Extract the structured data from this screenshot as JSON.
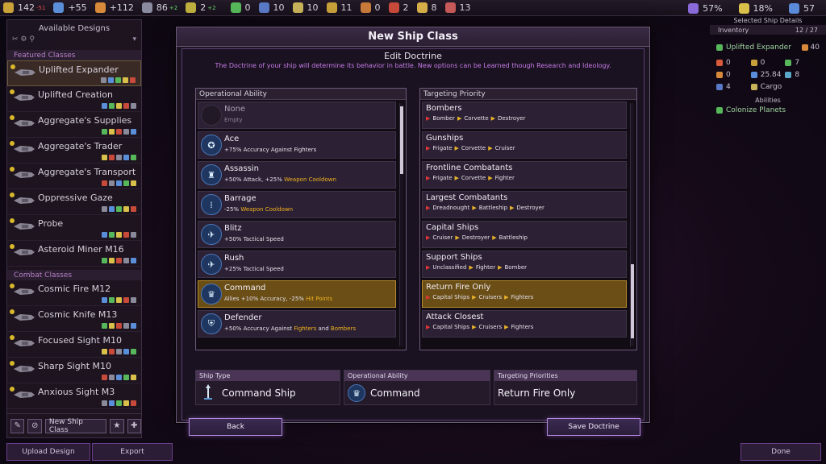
{
  "topbar": {
    "resources": [
      {
        "icon": "credits-icon",
        "value": "142",
        "delta": "-51",
        "delta_color": "red",
        "color": "#c9a23a"
      },
      {
        "icon": "science-icon",
        "value": "+55",
        "delta": "",
        "color": "#5a8ed8"
      },
      {
        "icon": "industry-icon",
        "value": "+112",
        "delta": "",
        "color": "#d88a3a"
      },
      {
        "icon": "manpower-icon",
        "value": "86",
        "delta": "+2",
        "delta_color": "green",
        "color": "#8a8aa0"
      },
      {
        "icon": "influence-icon",
        "value": "2",
        "delta": "+2",
        "delta_color": "green",
        "color": "#c0b040"
      }
    ],
    "strategic": [
      {
        "icon": "strategic-1-icon",
        "value": "0",
        "color": "#56b85a"
      },
      {
        "icon": "strategic-2-icon",
        "value": "10",
        "color": "#5a7ac8"
      },
      {
        "icon": "strategic-3-icon",
        "value": "10",
        "color": "#c8b25a"
      },
      {
        "icon": "strategic-4-icon",
        "value": "11",
        "color": "#c8a03a"
      },
      {
        "icon": "strategic-5-icon",
        "value": "0",
        "color": "#c87a3a"
      },
      {
        "icon": "strategic-6-icon",
        "value": "2",
        "color": "#c84a3a"
      },
      {
        "icon": "strategic-7-icon",
        "value": "8",
        "color": "#d8b04a"
      },
      {
        "icon": "strategic-8-icon",
        "value": "13",
        "color": "#c85a5a"
      }
    ],
    "right": [
      {
        "icon": "approval-icon",
        "value": "57%",
        "color": "#8a6ad8"
      },
      {
        "icon": "tax-icon",
        "value": "18%",
        "color": "#d8c04a"
      },
      {
        "icon": "population-icon",
        "value": "57",
        "color": "#5a8ad8"
      }
    ]
  },
  "left_panel": {
    "title": "Available Designs",
    "sections": [
      {
        "label": "Featured Classes",
        "items": [
          {
            "name": "Uplifted Expander",
            "selected": true
          },
          {
            "name": "Uplifted Creation",
            "selected": false
          },
          {
            "name": "Aggregate's Supplies",
            "selected": false
          },
          {
            "name": "Aggregate's Trader",
            "selected": false
          },
          {
            "name": "Aggregate's Transport",
            "selected": false
          },
          {
            "name": "Oppressive Gaze",
            "selected": false
          },
          {
            "name": "Probe",
            "selected": false
          },
          {
            "name": "Asteroid Miner M16",
            "selected": false
          }
        ]
      },
      {
        "label": "Combat Classes",
        "items": [
          {
            "name": "Cosmic Fire M12",
            "selected": false
          },
          {
            "name": "Cosmic Knife M13",
            "selected": false
          },
          {
            "name": "Focused Sight M10",
            "selected": false
          },
          {
            "name": "Sharp Sight M10",
            "selected": false
          },
          {
            "name": "Anxious Sight M3",
            "selected": false
          }
        ]
      }
    ],
    "new_ship_class_label": "New Ship Class",
    "upload_label": "Upload Design",
    "export_label": "Export"
  },
  "right_panel": {
    "header": "Selected Ship Details",
    "inventory_label": "Inventory",
    "inventory_value": "12 / 27",
    "ship_name": "Uplifted Expander",
    "ship_value": "40",
    "stats": [
      [
        "0",
        "0",
        "7"
      ],
      [
        "0",
        "25.84",
        "8"
      ],
      [
        "4",
        "Cargo",
        ""
      ]
    ],
    "abilities_label": "Abilities",
    "abilities": [
      "Colonize Planets"
    ],
    "done_label": "Done"
  },
  "modal": {
    "title": "New Ship Class",
    "subtitle": "Edit Doctrine",
    "description": "The Doctrine of your ship will determine its behavior in battle. New options can be Learned though Research and Ideology.",
    "operational_header": "Operational Ability",
    "targeting_header": "Targeting Priority",
    "abilities": [
      {
        "name": "None",
        "desc_parts": [
          {
            "t": "Empty",
            "hl": false
          }
        ],
        "icon": "empty-slot-icon",
        "glyph": "",
        "empty": true,
        "selected": false
      },
      {
        "name": "Ace",
        "desc_parts": [
          {
            "t": "+75% Accuracy Against Fighters",
            "hl": false
          }
        ],
        "icon": "ace-icon",
        "glyph": "✪",
        "empty": false,
        "selected": false
      },
      {
        "name": "Assassin",
        "desc_parts": [
          {
            "t": "+50% Attack, +25% ",
            "hl": false
          },
          {
            "t": "Weapon Cooldown",
            "hl": true
          }
        ],
        "icon": "assassin-icon",
        "glyph": "♜",
        "empty": false,
        "selected": false
      },
      {
        "name": "Barrage",
        "desc_parts": [
          {
            "t": "-25% ",
            "hl": false
          },
          {
            "t": "Weapon Cooldown",
            "hl": true
          }
        ],
        "icon": "barrage-icon",
        "glyph": "⁞",
        "empty": false,
        "selected": false
      },
      {
        "name": "Blitz",
        "desc_parts": [
          {
            "t": "+50% Tactical Speed",
            "hl": false
          }
        ],
        "icon": "blitz-icon",
        "glyph": "✈",
        "empty": false,
        "selected": false
      },
      {
        "name": "Rush",
        "desc_parts": [
          {
            "t": "+25% Tactical Speed",
            "hl": false
          }
        ],
        "icon": "rush-icon",
        "glyph": "✈",
        "empty": false,
        "selected": false
      },
      {
        "name": "Command",
        "desc_parts": [
          {
            "t": "Allies +10% Accuracy, -25% ",
            "hl": false
          },
          {
            "t": "Hit Points",
            "hl": true
          }
        ],
        "icon": "command-icon",
        "glyph": "♛",
        "empty": false,
        "selected": true
      },
      {
        "name": "Defender",
        "desc_parts": [
          {
            "t": "+50% Accuracy Against ",
            "hl": false
          },
          {
            "t": "Fighters",
            "hl": true
          },
          {
            "t": " and ",
            "hl": false
          },
          {
            "t": "Bombers",
            "hl": true
          }
        ],
        "icon": "defender-icon",
        "glyph": "⛨",
        "empty": false,
        "selected": false
      }
    ],
    "targets": [
      {
        "name": "Bombers",
        "chain": [
          "Bomber",
          "Corvette",
          "Destroyer"
        ],
        "selected": false
      },
      {
        "name": "Gunships",
        "chain": [
          "Frigate",
          "Corvette",
          "Cruiser"
        ],
        "selected": false
      },
      {
        "name": "Frontline Combatants",
        "chain": [
          "Frigate",
          "Corvette",
          "Fighter"
        ],
        "selected": false
      },
      {
        "name": "Largest Combatants",
        "chain": [
          "Dreadnought",
          "Battleship",
          "Destroyer"
        ],
        "selected": false
      },
      {
        "name": "Capital Ships",
        "chain": [
          "Cruiser",
          "Destroyer",
          "Battleship"
        ],
        "selected": false
      },
      {
        "name": "Support Ships",
        "chain": [
          "Unclassified",
          "Fighter",
          "Bomber"
        ],
        "selected": false
      },
      {
        "name": "Return Fire Only",
        "chain": [
          "Capital Ships",
          "Cruisers",
          "Fighters"
        ],
        "selected": true
      },
      {
        "name": "Attack Closest",
        "chain": [
          "Capital Ships",
          "Cruisers",
          "Fighters"
        ],
        "selected": false
      }
    ],
    "summary": {
      "ship_type_label": "Ship Type",
      "ship_type_value": "Command Ship",
      "ability_label": "Operational Ability",
      "ability_value": "Command",
      "priority_label": "Targeting Priorities",
      "priority_value": "Return Fire Only"
    },
    "back_label": "Back",
    "save_label": "Save Doctrine"
  }
}
